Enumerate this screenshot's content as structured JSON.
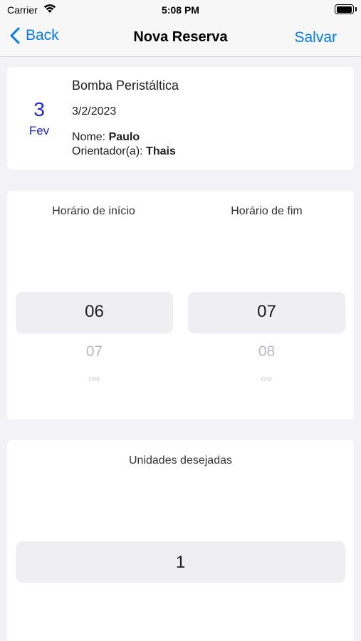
{
  "status_bar": {
    "carrier": "Carrier",
    "time": "5:08 PM",
    "battery_level": 1.0
  },
  "nav": {
    "back_label": "Back",
    "title": "Nova Reserva",
    "save_label": "Salvar",
    "accent_color": "#007aff"
  },
  "reservation": {
    "day": "3",
    "month": "Fev",
    "equipment": "Bomba Peristáltica",
    "date": "3/2/2023",
    "name_label": "Nome:",
    "name_value": "Paulo",
    "advisor_label": "Orientador(a):",
    "advisor_value": "Thais",
    "date_color": "#2224d6"
  },
  "time_pickers": {
    "start": {
      "label": "Horário de início",
      "selected": "06",
      "next": "07",
      "next2": "08"
    },
    "end": {
      "label": "Horário de fim",
      "selected": "07",
      "next": "08",
      "next2": "09"
    }
  },
  "units_picker": {
    "label": "Unidades desejadas",
    "selected": "1"
  }
}
